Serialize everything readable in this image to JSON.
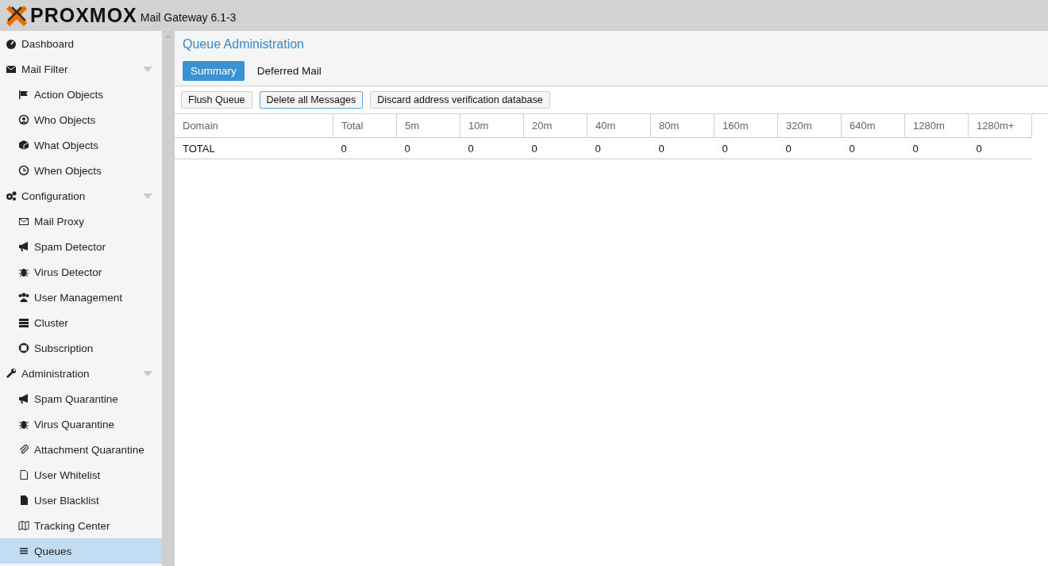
{
  "header": {
    "logo": "PROXMOX",
    "product": "Mail Gateway 6.1-3"
  },
  "sidebar": {
    "items": [
      {
        "label": "Dashboard",
        "selected": false
      },
      {
        "label": "Mail Filter",
        "selected": false,
        "expanded": true,
        "children": [
          {
            "label": "Action Objects",
            "selected": false
          },
          {
            "label": "Who Objects",
            "selected": false
          },
          {
            "label": "What Objects",
            "selected": false
          },
          {
            "label": "When Objects",
            "selected": false
          }
        ]
      },
      {
        "label": "Configuration",
        "selected": false,
        "expanded": true,
        "children": [
          {
            "label": "Mail Proxy",
            "selected": false
          },
          {
            "label": "Spam Detector",
            "selected": false
          },
          {
            "label": "Virus Detector",
            "selected": false
          },
          {
            "label": "User Management",
            "selected": false
          },
          {
            "label": "Cluster",
            "selected": false
          },
          {
            "label": "Subscription",
            "selected": false
          }
        ]
      },
      {
        "label": "Administration",
        "selected": false,
        "expanded": true,
        "children": [
          {
            "label": "Spam Quarantine",
            "selected": false
          },
          {
            "label": "Virus Quarantine",
            "selected": false
          },
          {
            "label": "Attachment Quarantine",
            "selected": false
          },
          {
            "label": "User Whitelist",
            "selected": false
          },
          {
            "label": "User Blacklist",
            "selected": false
          },
          {
            "label": "Tracking Center",
            "selected": false
          },
          {
            "label": "Queues",
            "selected": true
          }
        ]
      }
    ]
  },
  "panel": {
    "title": "Queue Administration",
    "tabs": [
      {
        "label": "Summary",
        "selected": true
      },
      {
        "label": "Deferred Mail",
        "selected": false
      }
    ],
    "buttons": [
      {
        "label": "Flush Queue",
        "focused": false
      },
      {
        "label": "Delete all Messages",
        "focused": true
      },
      {
        "label": "Discard address verification database",
        "focused": false
      }
    ],
    "table": {
      "columns": [
        "Domain",
        "Total",
        "5m",
        "10m",
        "20m",
        "40m",
        "80m",
        "160m",
        "320m",
        "640m",
        "1280m",
        "1280m+"
      ],
      "rows": [
        [
          "TOTAL",
          "0",
          "0",
          "0",
          "0",
          "0",
          "0",
          "0",
          "0",
          "0",
          "0",
          "0"
        ]
      ]
    }
  }
}
